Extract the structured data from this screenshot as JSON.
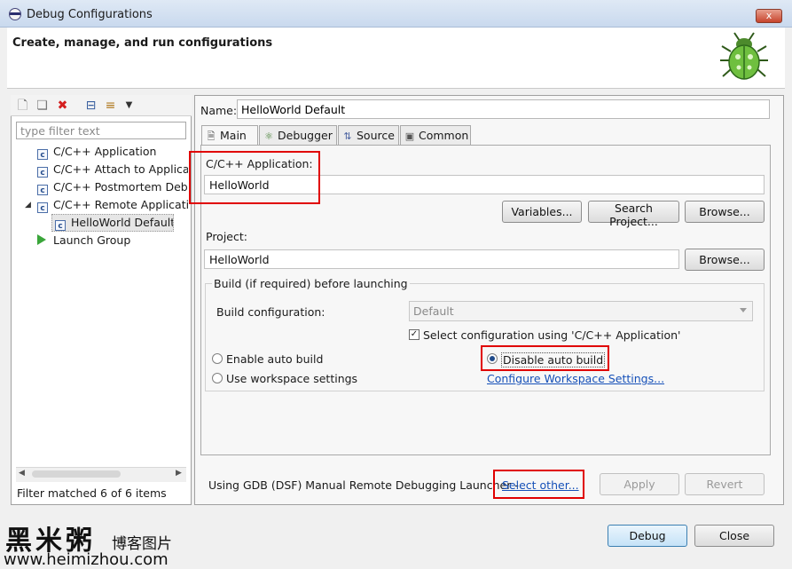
{
  "window": {
    "title": "Debug Configurations",
    "banner_title": "Create, manage, and run configurations",
    "close_glyph": "x"
  },
  "left": {
    "filter_placeholder": "type filter text",
    "tree": [
      {
        "label": "C/C++ Application",
        "icon": "c-config-icon"
      },
      {
        "label": "C/C++ Attach to Applicatio",
        "icon": "c-config-icon"
      },
      {
        "label": "C/C++ Postmortem Debu",
        "icon": "c-config-icon"
      },
      {
        "label": "C/C++ Remote Applicatio",
        "icon": "c-config-icon",
        "expanded": true
      },
      {
        "label": "HelloWorld Default",
        "icon": "c-config-icon",
        "selected": true
      },
      {
        "label": "Launch Group",
        "icon": "launch-group-icon"
      }
    ],
    "status": "Filter matched 6 of 6 items"
  },
  "right": {
    "name_label": "Name:",
    "name_value": "HelloWorld Default",
    "tabs": [
      {
        "label": "Main",
        "icon": "main-tab-icon"
      },
      {
        "label": "Debugger",
        "icon": "bug-tab-icon"
      },
      {
        "label": "Source",
        "icon": "source-tab-icon"
      },
      {
        "label": "Common",
        "icon": "common-tab-icon"
      }
    ],
    "main": {
      "app_label": "C/C++ Application:",
      "app_value": "HelloWorld",
      "variables_btn": "Variables...",
      "search_project_btn": "Search Project...",
      "browse_btn": "Browse...",
      "project_label": "Project:",
      "project_value": "HelloWorld",
      "project_browse_btn": "Browse...",
      "build_group_title": "Build (if required) before launching",
      "build_config_label": "Build configuration:",
      "build_config_value": "Default",
      "select_config_label": "Select configuration using 'C/C++ Application'",
      "enable_auto_build": "Enable auto build",
      "disable_auto_build": "Disable auto build",
      "use_workspace": "Use workspace settings",
      "configure_workspace_link": "Configure Workspace Settings..."
    },
    "launcher_text": "Using GDB (DSF) Manual Remote Debugging Launcher -",
    "select_other_link": "Select other...",
    "apply_btn": "Apply",
    "revert_btn": "Revert"
  },
  "footer": {
    "debug_btn": "Debug",
    "close_btn": "Close"
  },
  "watermark": {
    "chinese": "黑米粥",
    "sub": "博客图片",
    "url": "www.heimizhou.com"
  },
  "colors": {
    "highlight": "#e00000",
    "link": "#1550b8",
    "accent": "#3c7fb1"
  }
}
